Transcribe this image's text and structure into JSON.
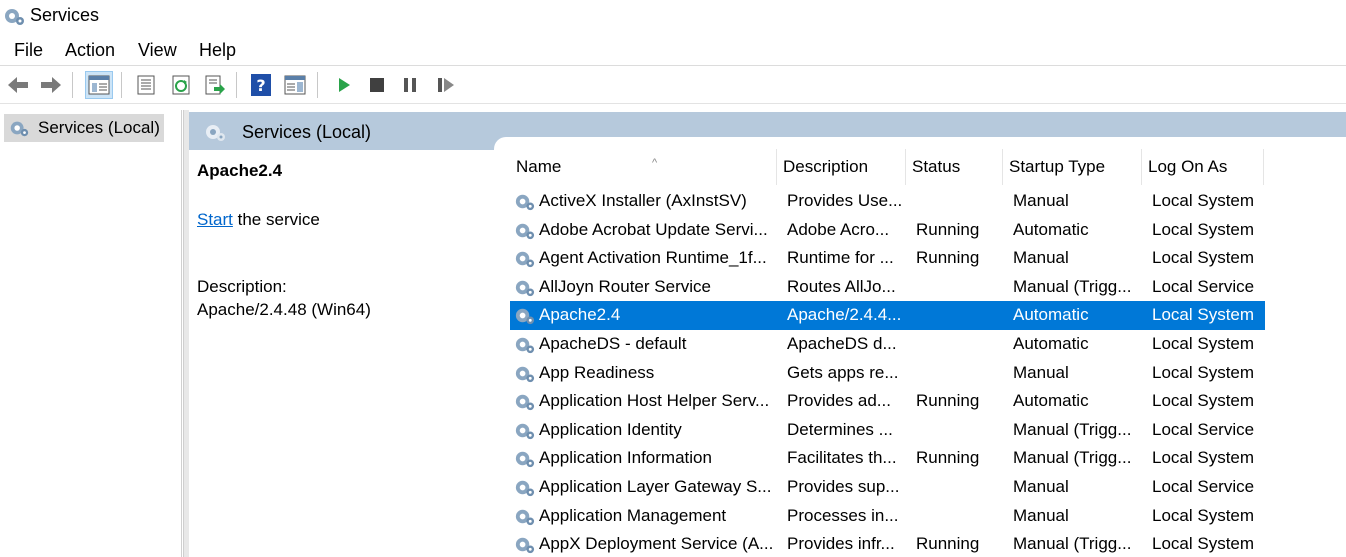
{
  "window": {
    "title": "Services",
    "icon": "gear-icon"
  },
  "menu": [
    "File",
    "Action",
    "View",
    "Help"
  ],
  "toolbar": {
    "buttons": [
      "back-arrow-icon",
      "forward-arrow-icon",
      "show-hide-tree-icon",
      "properties-icon",
      "refresh-icon",
      "export-list-icon",
      "help-icon",
      "show-action-pane-icon",
      "start-service-icon",
      "stop-service-icon",
      "pause-service-icon",
      "resume-service-icon"
    ],
    "colors": {
      "start": "#2aa34a",
      "stop": "#404040",
      "help": "#1f4fa8"
    }
  },
  "tree": {
    "root_label": "Services (Local)"
  },
  "pane": {
    "header": "Services (Local)",
    "header_color": "#b6c9dc",
    "selected_service": "Apache2.4",
    "start_link": "Start",
    "start_suffix": " the service",
    "description_label": "Description:",
    "description_text": "Apache/2.4.48 (Win64)"
  },
  "columns": [
    "Name",
    "Description",
    "Status",
    "Startup Type",
    "Log On As"
  ],
  "selection_color": "#0078d7",
  "rows": [
    {
      "name": "ActiveX Installer (AxInstSV)",
      "description": "Provides Use...",
      "status": "",
      "startup": "Manual",
      "logon": "Local System"
    },
    {
      "name": "Adobe Acrobat Update Servi...",
      "description": "Adobe Acro...",
      "status": "Running",
      "startup": "Automatic",
      "logon": "Local System"
    },
    {
      "name": "Agent Activation Runtime_1f...",
      "description": "Runtime for ...",
      "status": "Running",
      "startup": "Manual",
      "logon": "Local System"
    },
    {
      "name": "AllJoyn Router Service",
      "description": "Routes AllJo...",
      "status": "",
      "startup": "Manual (Trigg...",
      "logon": "Local Service"
    },
    {
      "name": "Apache2.4",
      "description": "Apache/2.4.4...",
      "status": "",
      "startup": "Automatic",
      "logon": "Local System",
      "selected": true
    },
    {
      "name": "ApacheDS - default",
      "description": "ApacheDS d...",
      "status": "",
      "startup": "Automatic",
      "logon": "Local System"
    },
    {
      "name": "App Readiness",
      "description": "Gets apps re...",
      "status": "",
      "startup": "Manual",
      "logon": "Local System"
    },
    {
      "name": "Application Host Helper Serv...",
      "description": "Provides ad...",
      "status": "Running",
      "startup": "Automatic",
      "logon": "Local System"
    },
    {
      "name": "Application Identity",
      "description": "Determines ...",
      "status": "",
      "startup": "Manual (Trigg...",
      "logon": "Local Service"
    },
    {
      "name": "Application Information",
      "description": "Facilitates th...",
      "status": "Running",
      "startup": "Manual (Trigg...",
      "logon": "Local System"
    },
    {
      "name": "Application Layer Gateway S...",
      "description": "Provides sup...",
      "status": "",
      "startup": "Manual",
      "logon": "Local Service"
    },
    {
      "name": "Application Management",
      "description": "Processes in...",
      "status": "",
      "startup": "Manual",
      "logon": "Local System"
    },
    {
      "name": "AppX Deployment Service (A...",
      "description": "Provides infr...",
      "status": "Running",
      "startup": "Manual (Trigg...",
      "logon": "Local System"
    }
  ]
}
